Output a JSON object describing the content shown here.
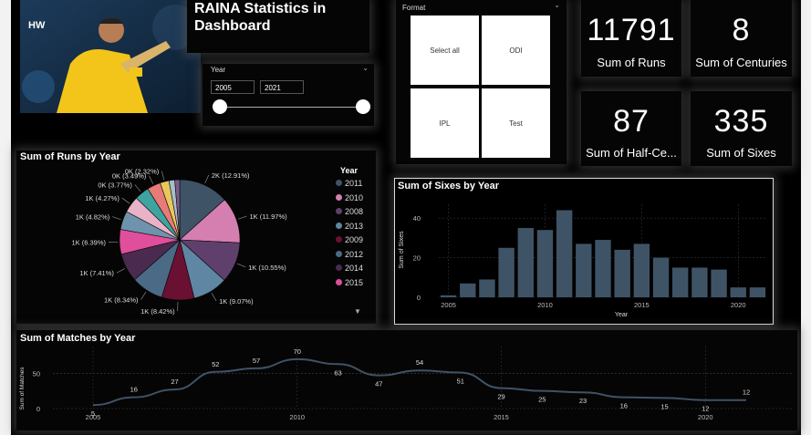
{
  "header": {
    "title": "RAINA Statistics in Dashboard",
    "logo": "HW"
  },
  "year_slicer": {
    "label": "Year",
    "start": "2005",
    "end": "2021"
  },
  "format_slicer": {
    "label": "Format",
    "options": [
      "Select all",
      "ODI",
      "IPL",
      "Test"
    ]
  },
  "kpis": [
    {
      "value": "11791",
      "label": "Sum of Runs"
    },
    {
      "value": "8",
      "label": "Sum of Centuries"
    },
    {
      "value": "87",
      "label": "Sum of Half-Ce..."
    },
    {
      "value": "335",
      "label": "Sum of Sixes"
    }
  ],
  "colors": {
    "primary_slate": "#3f5366",
    "pink": "#d57fb0",
    "purple": "#5f3f6c",
    "maroon": "#6a1033",
    "steel": "#5f86a2",
    "magenta": "#e04f9b"
  },
  "pie": {
    "title": "Sum of Runs by Year",
    "legend_title": "Year",
    "legend": [
      {
        "label": "2011",
        "color": "#3f5366"
      },
      {
        "label": "2010",
        "color": "#d57fb0"
      },
      {
        "label": "2008",
        "color": "#5f3f6c"
      },
      {
        "label": "2013",
        "color": "#5f86a2"
      },
      {
        "label": "2009",
        "color": "#6a1033"
      },
      {
        "label": "2012",
        "color": "#4a6a86"
      },
      {
        "label": "2014",
        "color": "#4a2a4e"
      },
      {
        "label": "2015",
        "color": "#e04f9b"
      }
    ]
  },
  "chart_data": [
    {
      "type": "pie",
      "title": "Sum of Runs by Year",
      "legend_title": "Year",
      "slices": [
        {
          "label": "2K (12.91%)",
          "value": 12.91,
          "color": "#3f5366"
        },
        {
          "label": "1K (11.97%)",
          "value": 11.97,
          "color": "#d57fb0"
        },
        {
          "label": "1K (10.55%)",
          "value": 10.55,
          "color": "#5f3f6c"
        },
        {
          "label": "1K (9.07%)",
          "value": 9.07,
          "color": "#5f86a2"
        },
        {
          "label": "1K (8.42%)",
          "value": 8.42,
          "color": "#6a1033"
        },
        {
          "label": "1K (8.34%)",
          "value": 8.34,
          "color": "#4a6a86"
        },
        {
          "label": "1K (7.41%)",
          "value": 7.41,
          "color": "#4a2a4e"
        },
        {
          "label": "1K (6.39%)",
          "value": 6.39,
          "color": "#e04f9b"
        },
        {
          "label": "1K (4.82%)",
          "value": 4.82,
          "color": "#6f93ac"
        },
        {
          "label": "1K (4.27%)",
          "value": 4.27,
          "color": "#e9b3c7"
        },
        {
          "label": "0K (3.77%)",
          "value": 3.77,
          "color": "#3fa3a0"
        },
        {
          "label": "0K (3.49%)",
          "value": 3.49,
          "color": "#e87a7a"
        },
        {
          "label": "0K (2.32%)",
          "value": 2.32,
          "color": "#e8c85a"
        },
        {
          "label": "",
          "value": 1.5,
          "color": "#a9bccb"
        },
        {
          "label": "",
          "value": 1.27,
          "color": "#7a5c8a"
        }
      ]
    },
    {
      "type": "bar",
      "title": "Sum of Sixes by Year",
      "xlabel": "Year",
      "ylabel": "Sum of Sixes",
      "x": [
        2005,
        2006,
        2007,
        2008,
        2009,
        2010,
        2011,
        2012,
        2013,
        2014,
        2015,
        2016,
        2017,
        2018,
        2019,
        2020,
        2021
      ],
      "values": [
        1,
        7,
        9,
        25,
        35,
        34,
        44,
        27,
        29,
        24,
        27,
        20,
        15,
        15,
        14,
        5,
        5
      ],
      "ylim": [
        0,
        47
      ],
      "yticks": [
        0,
        20,
        40
      ],
      "xticks": [
        2005,
        2010,
        2015,
        2020
      ],
      "color": "#3f5366"
    },
    {
      "type": "line",
      "title": "Sum of Matches by Year",
      "ylabel": "Sum of Matches",
      "x": [
        2005,
        2006,
        2007,
        2008,
        2009,
        2010,
        2011,
        2012,
        2013,
        2014,
        2015,
        2016,
        2017,
        2018,
        2019,
        2020,
        2021
      ],
      "values": [
        5,
        16,
        27,
        52,
        57,
        70,
        63,
        47,
        54,
        51,
        29,
        25,
        23,
        16,
        15,
        12,
        12
      ],
      "ylim": [
        0,
        75
      ],
      "yticks": [
        0,
        50
      ],
      "xticks": [
        2005,
        2010,
        2015,
        2020
      ],
      "color": "#3f5366"
    }
  ]
}
